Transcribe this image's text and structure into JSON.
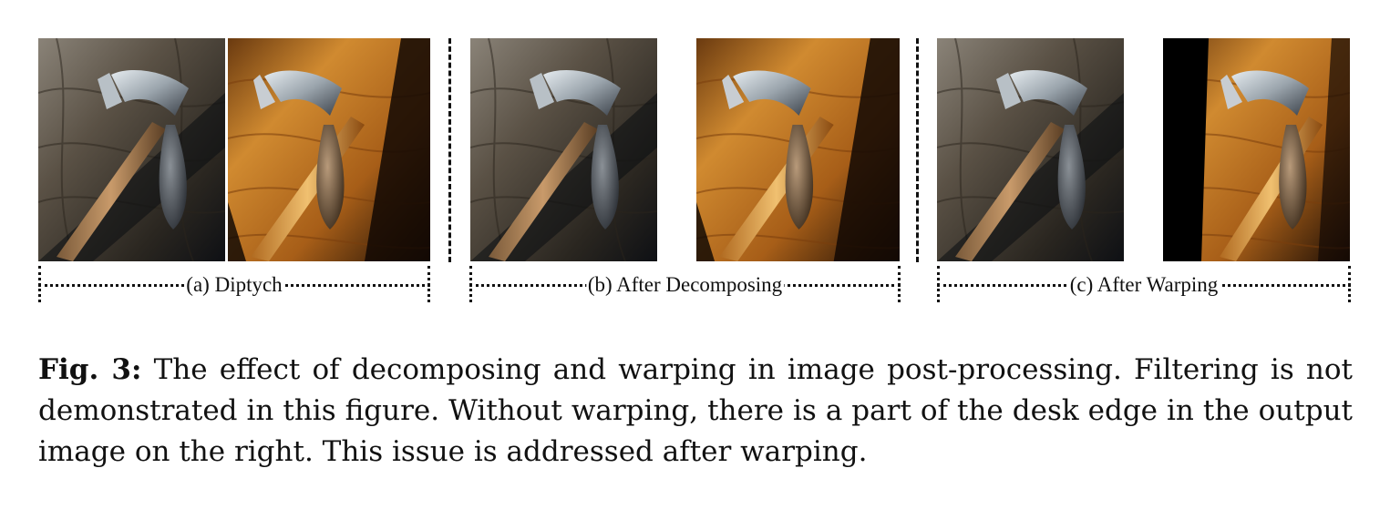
{
  "panels": {
    "a": {
      "label": "(a) Diptych",
      "left_image": "hammer-photo-cool",
      "right_image": "hammer-photo-warm"
    },
    "b": {
      "label": "(b) After Decomposing",
      "left_image": "hammer-photo-cool",
      "right_image": "hammer-photo-warm"
    },
    "c": {
      "label": "(c) After Warping",
      "left_image": "hammer-photo-cool",
      "right_image": "hammer-photo-warm-warped"
    }
  },
  "caption": {
    "label": "Fig. 3:",
    "text": " The effect of decomposing and warping in image post-processing. Filtering is not demonstrated in this figure. Without warping, there is a part of the desk edge in the output image on the right. This issue is addressed after warping."
  },
  "colors": {
    "cool_wood": "#4a4236",
    "warm_wood": "#b86a1c",
    "dark_shadow": "#0c0f14",
    "metal": "#9ea6ad"
  }
}
